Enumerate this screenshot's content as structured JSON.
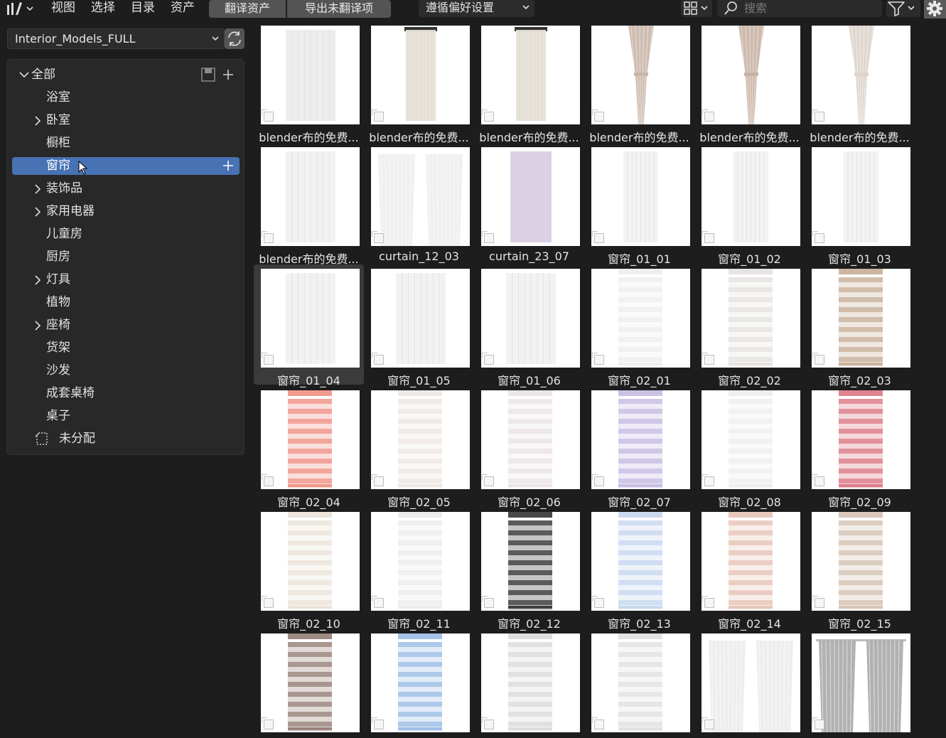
{
  "header": {
    "menus": [
      "视图",
      "选择",
      "目录",
      "资产"
    ],
    "segments": [
      "翻译资产",
      "导出未翻译项"
    ],
    "import_dropdown": "遵循偏好设置",
    "search_placeholder": "搜索"
  },
  "sidebar": {
    "library": "Interior_Models_FULL",
    "tree": [
      {
        "label": "全部",
        "level": 0,
        "expanded": true,
        "expandable": true
      },
      {
        "label": "浴室",
        "level": 1,
        "expandable": false
      },
      {
        "label": "卧室",
        "level": 1,
        "expandable": true
      },
      {
        "label": "橱柜",
        "level": 1,
        "expandable": false
      },
      {
        "label": "窗帘",
        "level": 1,
        "expandable": false,
        "selected": true
      },
      {
        "label": "装饰品",
        "level": 1,
        "expandable": true
      },
      {
        "label": "家用电器",
        "level": 1,
        "expandable": true
      },
      {
        "label": "儿童房",
        "level": 1,
        "expandable": false
      },
      {
        "label": "厨房",
        "level": 1,
        "expandable": false
      },
      {
        "label": "灯具",
        "level": 1,
        "expandable": true
      },
      {
        "label": "植物",
        "level": 1,
        "expandable": false
      },
      {
        "label": "座椅",
        "level": 1,
        "expandable": true
      },
      {
        "label": "货架",
        "level": 1,
        "expandable": false
      },
      {
        "label": "沙发",
        "level": 1,
        "expandable": false
      },
      {
        "label": "成套桌椅",
        "level": 1,
        "expandable": false
      },
      {
        "label": "桌子",
        "level": 1,
        "expandable": false
      }
    ],
    "unassigned": "未分配"
  },
  "assets": [
    {
      "name": "blender布的免费...",
      "style": "panel",
      "color": "#ececec",
      "w": 0.5
    },
    {
      "name": "blender布的免费...",
      "style": "panel",
      "color": "#e7e0d6",
      "w": 0.3,
      "rod": true
    },
    {
      "name": "blender布的免费...",
      "style": "panel",
      "color": "#e7e0d6",
      "w": 0.3,
      "rod": true
    },
    {
      "name": "blender布的免费...",
      "style": "tied",
      "color": "#c9b6a8"
    },
    {
      "name": "blender布的免费...",
      "style": "tied",
      "color": "#c9b2a4"
    },
    {
      "name": "blender布的免费...",
      "style": "tied",
      "color": "#ddd3ca"
    },
    {
      "name": "blender布的免费...",
      "style": "panel",
      "color": "#f1f1f1",
      "w": 0.5
    },
    {
      "name": "curtain_12_03",
      "style": "double",
      "color": "#eeeeee"
    },
    {
      "name": "curtain_23_07",
      "style": "panel",
      "color": "#d9cde3",
      "w": 0.42
    },
    {
      "name": "窗帘_01_01",
      "style": "panel",
      "color": "#f2f2f2",
      "w": 0.35
    },
    {
      "name": "窗帘_01_02",
      "style": "panel",
      "color": "#f2f2f2",
      "w": 0.35
    },
    {
      "name": "窗帘_01_03",
      "style": "panel",
      "color": "#f2f2f2",
      "w": 0.35
    },
    {
      "name": "窗帘_01_04",
      "style": "panel",
      "color": "#f1f1f1",
      "w": 0.5,
      "selected": true
    },
    {
      "name": "窗帘_01_05",
      "style": "panel",
      "color": "#f1f1f1",
      "w": 0.5
    },
    {
      "name": "窗帘_01_06",
      "style": "panel",
      "color": "#f1f1f1",
      "w": 0.5
    },
    {
      "name": "窗帘_02_01",
      "style": "blind",
      "color": "#eeeeee"
    },
    {
      "name": "窗帘_02_02",
      "style": "blind",
      "color": "#e6e3e1"
    },
    {
      "name": "窗帘_02_03",
      "style": "blind",
      "color": "#c9b29c"
    },
    {
      "name": "窗帘_02_04",
      "style": "blind",
      "color": "#f0968a"
    },
    {
      "name": "窗帘_02_05",
      "style": "blind",
      "color": "#eee8e4"
    },
    {
      "name": "窗帘_02_06",
      "style": "blind",
      "color": "#ebe4e8"
    },
    {
      "name": "窗帘_02_07",
      "style": "blind",
      "color": "#c9bde3"
    },
    {
      "name": "窗帘_02_08",
      "style": "blind",
      "color": "#eeeeee"
    },
    {
      "name": "窗帘_02_09",
      "style": "blind",
      "color": "#dd7e8a"
    },
    {
      "name": "窗帘_02_10",
      "style": "blind",
      "color": "#ece4da"
    },
    {
      "name": "窗帘_02_11",
      "style": "blind",
      "color": "#ececec"
    },
    {
      "name": "窗帘_02_12",
      "style": "blind",
      "color": "#3e3e3e"
    },
    {
      "name": "窗帘_02_13",
      "style": "blind",
      "color": "#c8d8f0"
    },
    {
      "name": "窗帘_02_14",
      "style": "blind",
      "color": "#e8c6b8"
    },
    {
      "name": "窗帘_02_15",
      "style": "blind",
      "color": "#d6c4b6"
    },
    {
      "name": "",
      "style": "blind",
      "color": "#9a847c"
    },
    {
      "name": "",
      "style": "blind",
      "color": "#9fc0e6"
    },
    {
      "name": "",
      "style": "blind",
      "color": "#dcdcdc"
    },
    {
      "name": "",
      "style": "blind",
      "color": "#e2e2e2"
    },
    {
      "name": "",
      "style": "double",
      "color": "#ececec"
    },
    {
      "name": "",
      "style": "double",
      "color": "#a9a9a9",
      "rod": true
    }
  ]
}
